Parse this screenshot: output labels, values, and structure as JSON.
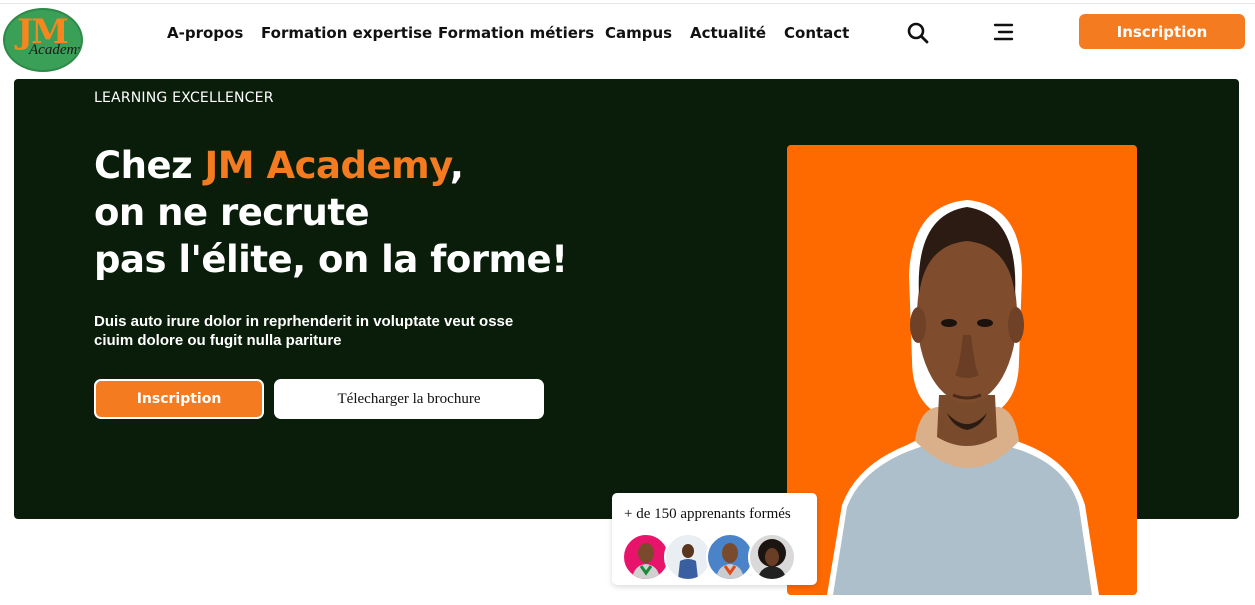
{
  "brand": {
    "logo_text_top": "JM",
    "logo_text_bottom": "Academy"
  },
  "nav": [
    {
      "label": "A-propos"
    },
    {
      "label": "Formation expertise"
    },
    {
      "label": "Formation métiers"
    },
    {
      "label": "Campus"
    },
    {
      "label": "Actualité"
    },
    {
      "label": "Contact"
    }
  ],
  "header": {
    "search_icon": "search-icon",
    "menu_icon": "menu-icon",
    "cta_label": "Inscription"
  },
  "hero": {
    "eyebrow": "LEARNING EXCELLENCER",
    "headline_prefix": "Chez ",
    "headline_brand": "JM Academy",
    "headline_comma": ",",
    "headline_line2": "on ne recrute",
    "headline_line3": "pas l'élite, on la forme!",
    "description": "Duis auto irure dolor in reprhenderit in voluptate veut osse ciuim dolore ou fugit nulla pariture",
    "primary_cta": "Inscription",
    "secondary_cta": "Télecharger la brochure"
  },
  "learners": {
    "text": "+ de 150 apprenants formés",
    "avatar_count": 4
  },
  "colors": {
    "accent": "#f47b20",
    "hero_bg": "#0a1d0a",
    "portrait_bg": "#ff6a00"
  }
}
